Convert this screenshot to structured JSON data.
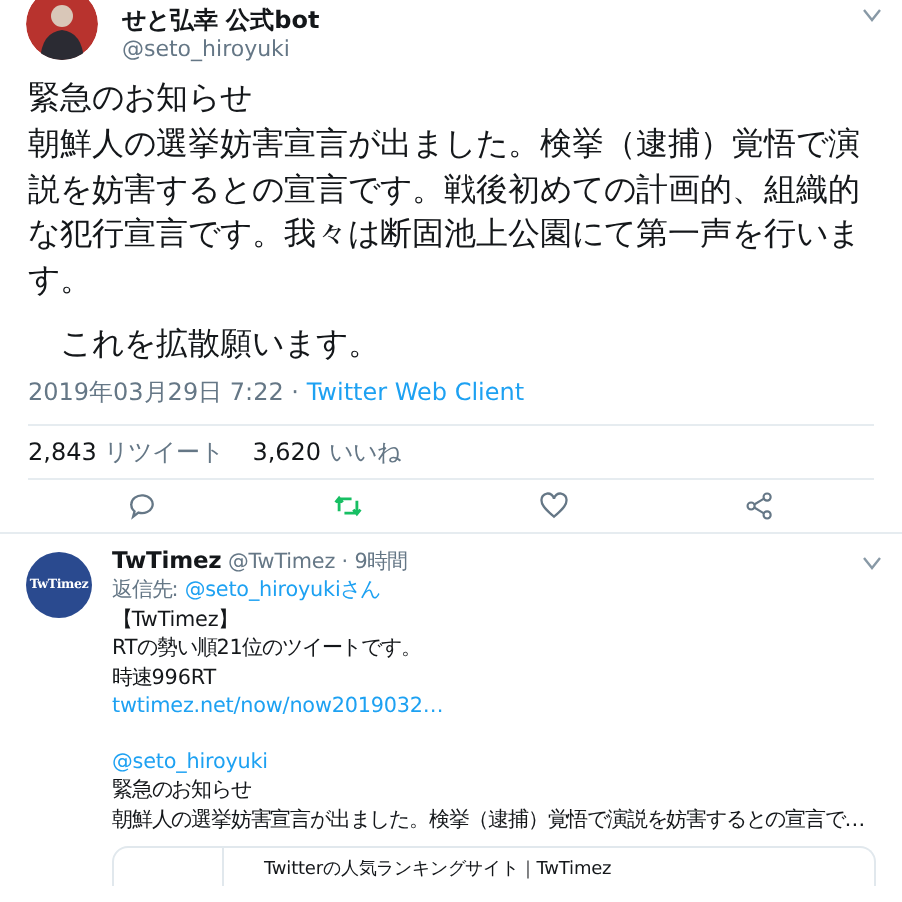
{
  "tweet": {
    "display_name": "せと弘幸 公式bot",
    "handle": "@seto_hiroyuki",
    "paragraphs": [
      {
        "text": "緊急のお知らせ",
        "indented": false
      },
      {
        "text": "朝鮮人の選挙妨害宣言が出ました。検挙（逮捕）覚悟で演説を妨害するとの宣言です。戦後初めての計画的、組織的な犯行宣言です。我々は断固池上公園にて第一声を行います。",
        "indented": false
      },
      {
        "text": "これを拡散願います。",
        "indented": true
      }
    ],
    "timestamp": "2019年03月29日 7:22",
    "separator": "·",
    "client": "Twitter Web Client",
    "stats": [
      {
        "count": "2,843",
        "label": "リツイート"
      },
      {
        "count": "3,620",
        "label": "いいね"
      }
    ],
    "actions": [
      {
        "kind": "reply",
        "active": false
      },
      {
        "kind": "retweet",
        "active": true
      },
      {
        "kind": "like",
        "active": false
      },
      {
        "kind": "share",
        "active": false
      }
    ]
  },
  "reply": {
    "avatar_text": "TwTimez",
    "display_name": "TwTimez",
    "handle": "@TwTimez",
    "separator": "·",
    "time": "9時間",
    "reply_label": "返信先:",
    "reply_to": "@seto_hiroyukiさん",
    "lines": [
      {
        "kind": "text",
        "text": "【TwTimez】"
      },
      {
        "kind": "text",
        "text": "RTの勢い順21位のツイートです。"
      },
      {
        "kind": "text",
        "text": "時速996RT"
      },
      {
        "kind": "link",
        "text": "twtimez.net/now/now2019032…"
      },
      {
        "kind": "link",
        "text": "@seto_hiroyuki",
        "gap_before": true
      },
      {
        "kind": "text",
        "text": "緊急のお知らせ"
      },
      {
        "kind": "text",
        "text": "朝鮮人の選挙妨害宣言が出ました。検挙（逮捕）覚悟で演説を妨害するとの宣言で…"
      }
    ],
    "card_title": "Twitterの人気ランキングサイト｜TwTimez"
  }
}
